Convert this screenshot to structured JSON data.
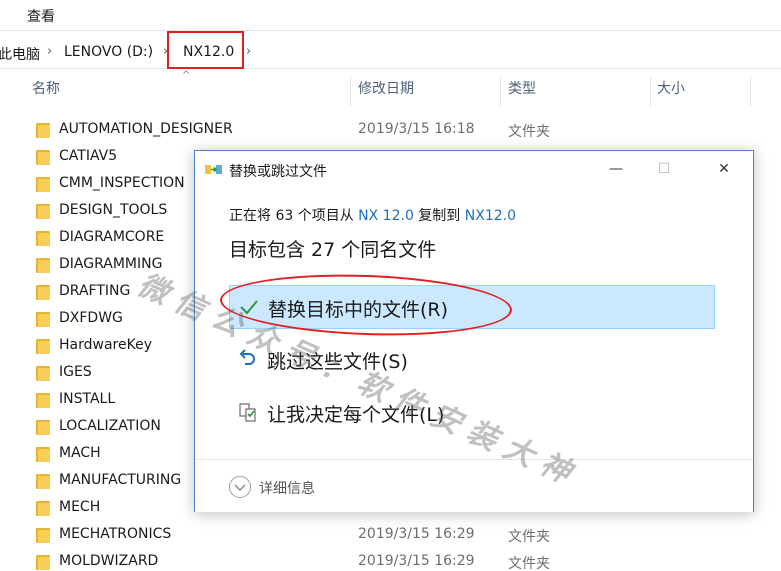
{
  "ribbon": {
    "view_tab": "查看"
  },
  "address": {
    "crumbs": [
      "此电脑",
      "LENOVO (D:)",
      "NX12.0"
    ],
    "separator": "›"
  },
  "columns": {
    "name": "名称",
    "modified": "修改日期",
    "type": "类型",
    "size": "大小"
  },
  "files": [
    {
      "name": "AUTOMATION_DESIGNER",
      "date": "2019/3/15 16:18",
      "type": "文件夹"
    },
    {
      "name": "CATIAV5",
      "date": "",
      "type": ""
    },
    {
      "name": "CMM_INSPECTION",
      "date": "",
      "type": ""
    },
    {
      "name": "DESIGN_TOOLS",
      "date": "",
      "type": ""
    },
    {
      "name": "DIAGRAMCORE",
      "date": "",
      "type": ""
    },
    {
      "name": "DIAGRAMMING",
      "date": "",
      "type": ""
    },
    {
      "name": "DRAFTING",
      "date": "",
      "type": ""
    },
    {
      "name": "DXFDWG",
      "date": "",
      "type": ""
    },
    {
      "name": "HardwareKey",
      "date": "",
      "type": ""
    },
    {
      "name": "IGES",
      "date": "",
      "type": ""
    },
    {
      "name": "INSTALL",
      "date": "",
      "type": ""
    },
    {
      "name": "LOCALIZATION",
      "date": "",
      "type": ""
    },
    {
      "name": "MACH",
      "date": "",
      "type": ""
    },
    {
      "name": "MANUFACTURING",
      "date": "",
      "type": ""
    },
    {
      "name": "MECH",
      "date": "",
      "type": ""
    },
    {
      "name": "MECHATRONICS",
      "date": "2019/3/15 16:29",
      "type": "文件夹"
    },
    {
      "name": "MOLDWIZARD",
      "date": "2019/3/15 16:29",
      "type": "文件夹"
    }
  ],
  "dialog": {
    "title": "替换或跳过文件",
    "minimize": "—",
    "maximize": "☐",
    "close": "✕",
    "sub_prefix": "正在将 63 个项目从 ",
    "source": "NX 12.0",
    "sub_middle": " 复制到 ",
    "dest": "NX12.0",
    "heading": "目标包含 27 个同名文件",
    "options": [
      {
        "label": "替换目标中的文件(R)",
        "icon": "check-icon"
      },
      {
        "label": "跳过这些文件(S)",
        "icon": "undo-arrow-icon"
      },
      {
        "label": "让我决定每个文件(L)",
        "icon": "compare-files-icon"
      }
    ],
    "details": "详细信息"
  },
  "watermark": "微信公众号：软件安装大神",
  "colors": {
    "accent": "#1a6fc4",
    "selected_bg": "#cce8ff",
    "annotation": "#e02020",
    "folder": "#f7cf56"
  }
}
